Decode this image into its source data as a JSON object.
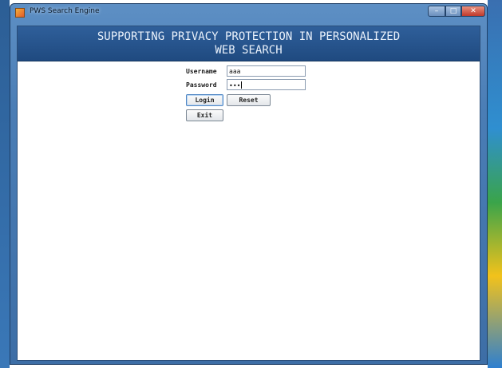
{
  "window": {
    "title": "PWS Search Engine",
    "controls": {
      "minimize": "–",
      "maximize": "□",
      "close": "✕"
    }
  },
  "banner": {
    "line1": "SUPPORTING PRIVACY PROTECTION IN PERSONALIZED",
    "line2": "WEB SEARCH"
  },
  "form": {
    "username_label": "Username",
    "username_value": "aaa",
    "password_label": "Password",
    "password_value": "•••"
  },
  "buttons": {
    "login": "Login",
    "reset": "Reset",
    "exit": "Exit"
  },
  "colors": {
    "banner_bg": "#1f4a80",
    "banner_text": "#e9f1fb",
    "close_button": "#c0392b"
  }
}
